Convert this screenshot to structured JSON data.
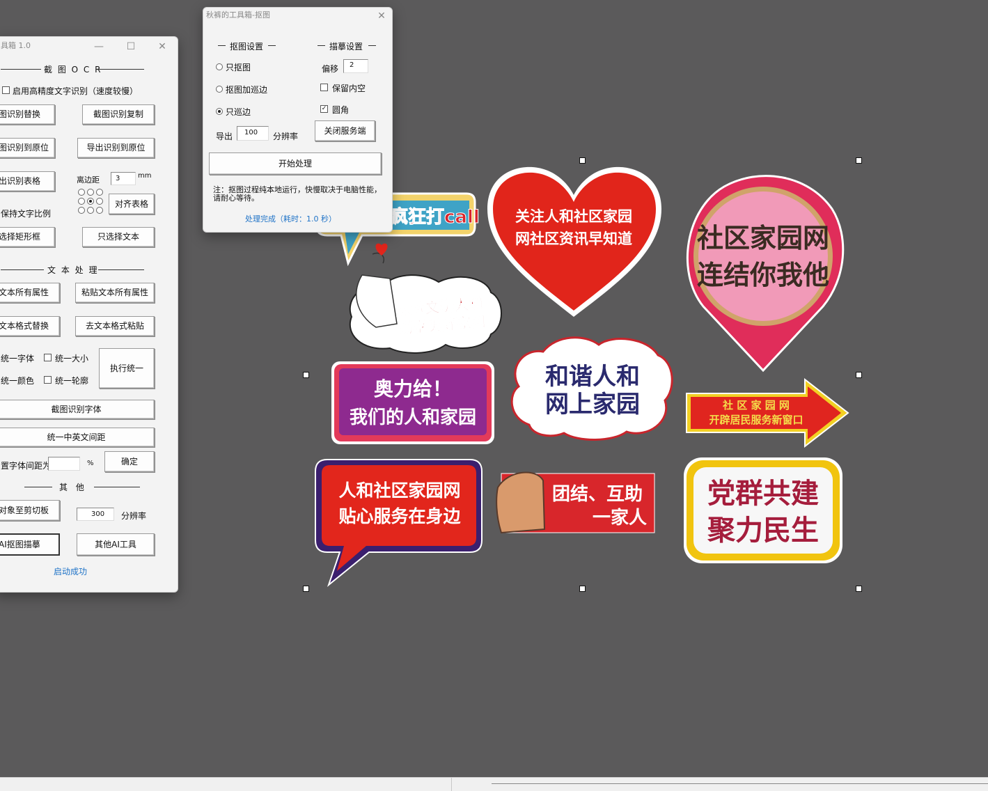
{
  "main_window": {
    "title": "具箱 1.0",
    "ocr_section": "截 图 O C R",
    "high_precision_label": "启用高精度文字识别（速度较慢）",
    "btn_ocr_replace": "图识别替换",
    "btn_ocr_copy": "截图识别复制",
    "btn_ocr_to_origin": "图识别到原位",
    "btn_export_to_origin": "导出识别到原位",
    "btn_export_table": "出识别表格",
    "margin_label": "离边距",
    "margin_value": "3",
    "margin_unit": "mm",
    "btn_align_table": "对齐表格",
    "keep_ratio": "保持文字比例",
    "btn_select_rect": "选择矩形框",
    "btn_select_text": "只选择文本",
    "text_section": "文 本 处 理",
    "btn_copy_props": "文本所有属性",
    "btn_paste_props": "粘贴文本所有属性",
    "btn_format_replace": "文本格式替换",
    "btn_remove_format": "去文本格式粘贴",
    "unify_font": "统一字体",
    "unify_size": "统一大小",
    "unify_color": "统一颜色",
    "unify_outline": "统一轮廓",
    "btn_execute_unify": "执行统一",
    "btn_ocr_font": "截图识别字体",
    "btn_unify_spacing": "统一中英文间距",
    "spacing_label": "置字体间距为",
    "spacing_unit": "%",
    "btn_confirm": "确定",
    "other_section": "其 他",
    "btn_to_clipboard": "对象至剪切板",
    "resolution_value": "300",
    "resolution_label": "分辨率",
    "btn_ai_cutout": "AI抠图描摹",
    "btn_other_ai": "其他AI工具",
    "status": "启动成功"
  },
  "cutout_window": {
    "title": "秋裤的工具箱-抠图",
    "cutout_settings": "抠图设置",
    "trace_settings": "描摹设置",
    "opt_cutout_only": "只抠图",
    "opt_cutout_edge": "抠图加巡边",
    "opt_edge_only": "只巡边",
    "offset_label": "偏移",
    "offset_value": "2",
    "keep_hollow": "保留内空",
    "rounded": "圆角",
    "export_label": "导出",
    "export_value": "100",
    "export_resolution": "分辨率",
    "btn_close_server": "关闭服务端",
    "btn_start": "开始处理",
    "note": "注：抠图过程纯本地运行，快慢取决于电脑性能，请耐心等待。",
    "status": "处理完成（耗时：1.0 秒）"
  },
  "stickers": {
    "s1": "疯狂打call",
    "s2a": "关注人和社区家园",
    "s2b": "网社区资讯早知道",
    "s3a": "社区家园网",
    "s3b": "连结你我他",
    "s4a": "点赞文明人和",
    "s4b": "畅享美好家园",
    "s5a": "奥力给！",
    "s5b": "我们的人和家园",
    "s6a": "和谐人和",
    "s6b": "网上家园",
    "s7a": "社 区 家 园 网",
    "s7b": "开辟居民服务新窗口",
    "s8a": "人和社区家园网",
    "s8b": "贴心服务在身边",
    "s9a": "团结、互助",
    "s9b": "一家人",
    "s10a": "党群共建",
    "s10b": "聚力民生"
  }
}
